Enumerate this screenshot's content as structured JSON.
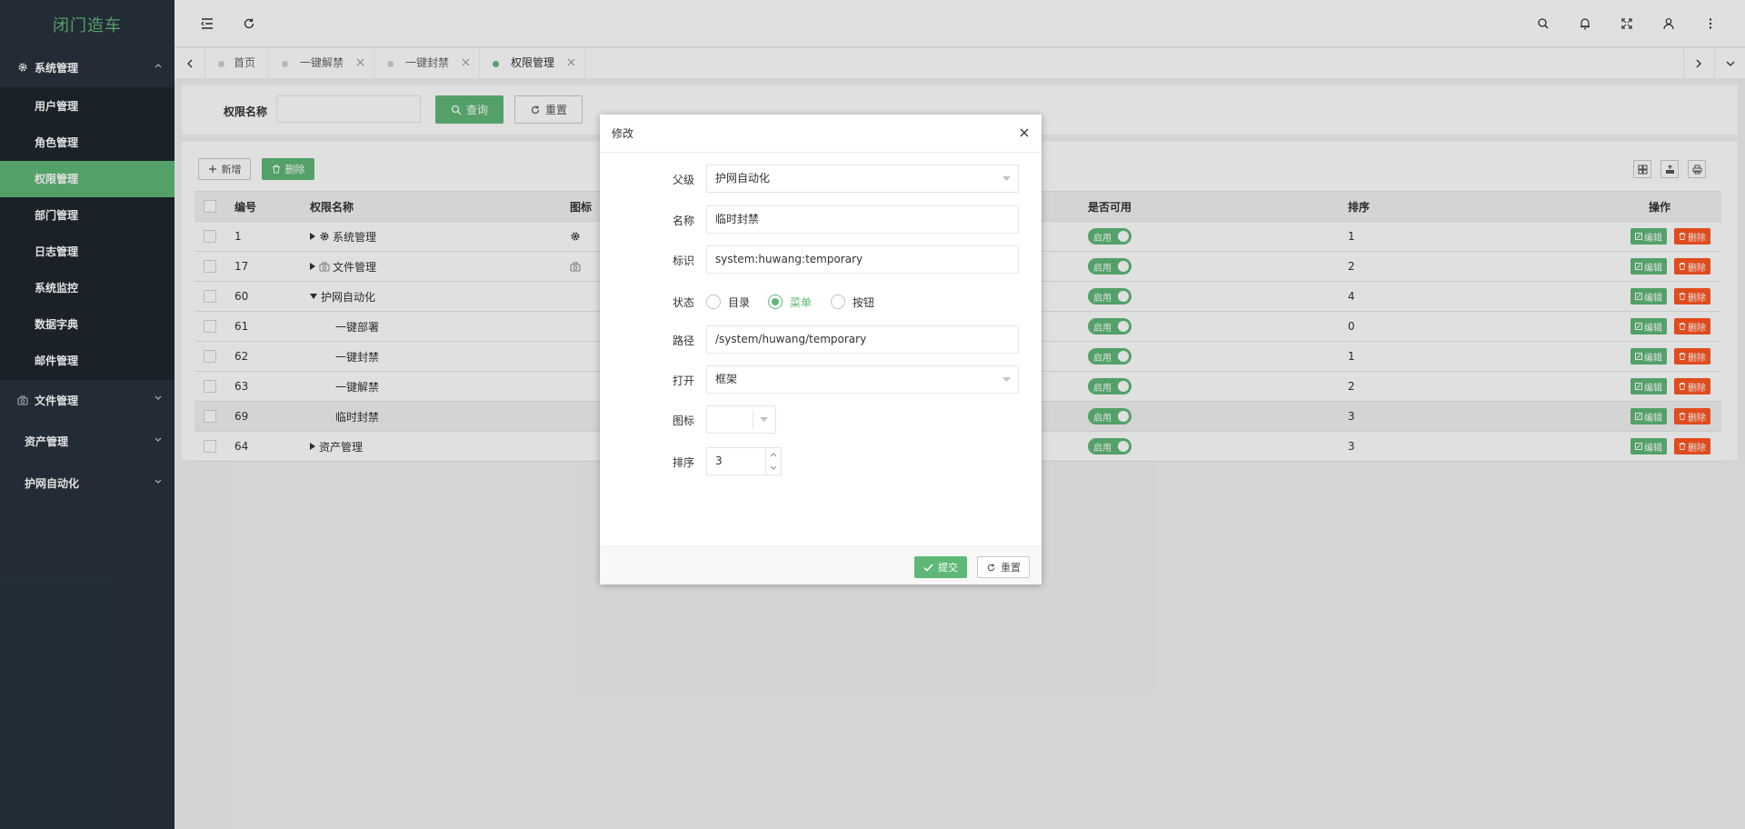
{
  "logo": "闭门造车",
  "sidebar": {
    "group1": "系统管理",
    "items": [
      "用户管理",
      "角色管理",
      "权限管理",
      "部门管理",
      "日志管理",
      "系统监控",
      "数据字典",
      "邮件管理"
    ],
    "group2": "文件管理",
    "group3": "资产管理",
    "group4": "护网自动化"
  },
  "tabs": [
    {
      "label": "首页",
      "closable": false
    },
    {
      "label": "一键解禁",
      "closable": true
    },
    {
      "label": "一键封禁",
      "closable": true
    },
    {
      "label": "权限管理",
      "closable": true,
      "active": true
    }
  ],
  "search": {
    "label": "权限名称",
    "query_btn": "查询",
    "reset_btn": "重置"
  },
  "toolbar": {
    "add_btn": "新增",
    "del_btn": "删除"
  },
  "table": {
    "headers": [
      "编号",
      "权限名称",
      "图标",
      "是否可用",
      "排序",
      "操作"
    ],
    "rows": [
      {
        "id": "1",
        "name": "系统管理",
        "tree": "collapsed",
        "icon": "gear-icon",
        "indent": 0,
        "enabled": "启用",
        "sort": "1"
      },
      {
        "id": "17",
        "name": "文件管理",
        "tree": "collapsed",
        "icon": "camera-icon",
        "indent": 0,
        "enabled": "启用",
        "sort": "2"
      },
      {
        "id": "60",
        "name": "护网自动化",
        "tree": "expanded",
        "icon": "",
        "indent": 0,
        "enabled": "启用",
        "sort": "4"
      },
      {
        "id": "61",
        "name": "一键部署",
        "tree": "leaf",
        "icon": "",
        "indent": 1,
        "enabled": "启用",
        "sort": "0"
      },
      {
        "id": "62",
        "name": "一键封禁",
        "tree": "leaf",
        "icon": "",
        "indent": 1,
        "enabled": "启用",
        "sort": "1"
      },
      {
        "id": "63",
        "name": "一键解禁",
        "tree": "leaf",
        "icon": "",
        "indent": 1,
        "enabled": "启用",
        "sort": "2"
      },
      {
        "id": "69",
        "name": "临时封禁",
        "tree": "leaf",
        "icon": "",
        "indent": 1,
        "enabled": "启用",
        "sort": "3"
      },
      {
        "id": "64",
        "name": "资产管理",
        "tree": "collapsed",
        "icon": "",
        "indent": 0,
        "enabled": "启用",
        "sort": "3"
      }
    ],
    "edit_label": "编辑",
    "delete_label": "删除"
  },
  "modal": {
    "title": "修改",
    "parent_label": "父级",
    "parent_value": "护网自动化",
    "name_label": "名称",
    "name_value": "临时封禁",
    "perm_label": "标识",
    "perm_value": "system:huwang:temporary",
    "state_label": "状态",
    "state_options": [
      "目录",
      "菜单",
      "按钮"
    ],
    "state_selected": "菜单",
    "path_label": "路径",
    "path_value": "/system/huwang/temporary",
    "open_label": "打开",
    "open_value": "框架",
    "icon_label": "图标",
    "sort_label": "排序",
    "sort_value": "3",
    "submit_btn": "提交",
    "reset_btn": "重置"
  },
  "colors": {
    "accent": "#5fb878",
    "danger": "#ff5722",
    "sidebar": "#28333e"
  }
}
